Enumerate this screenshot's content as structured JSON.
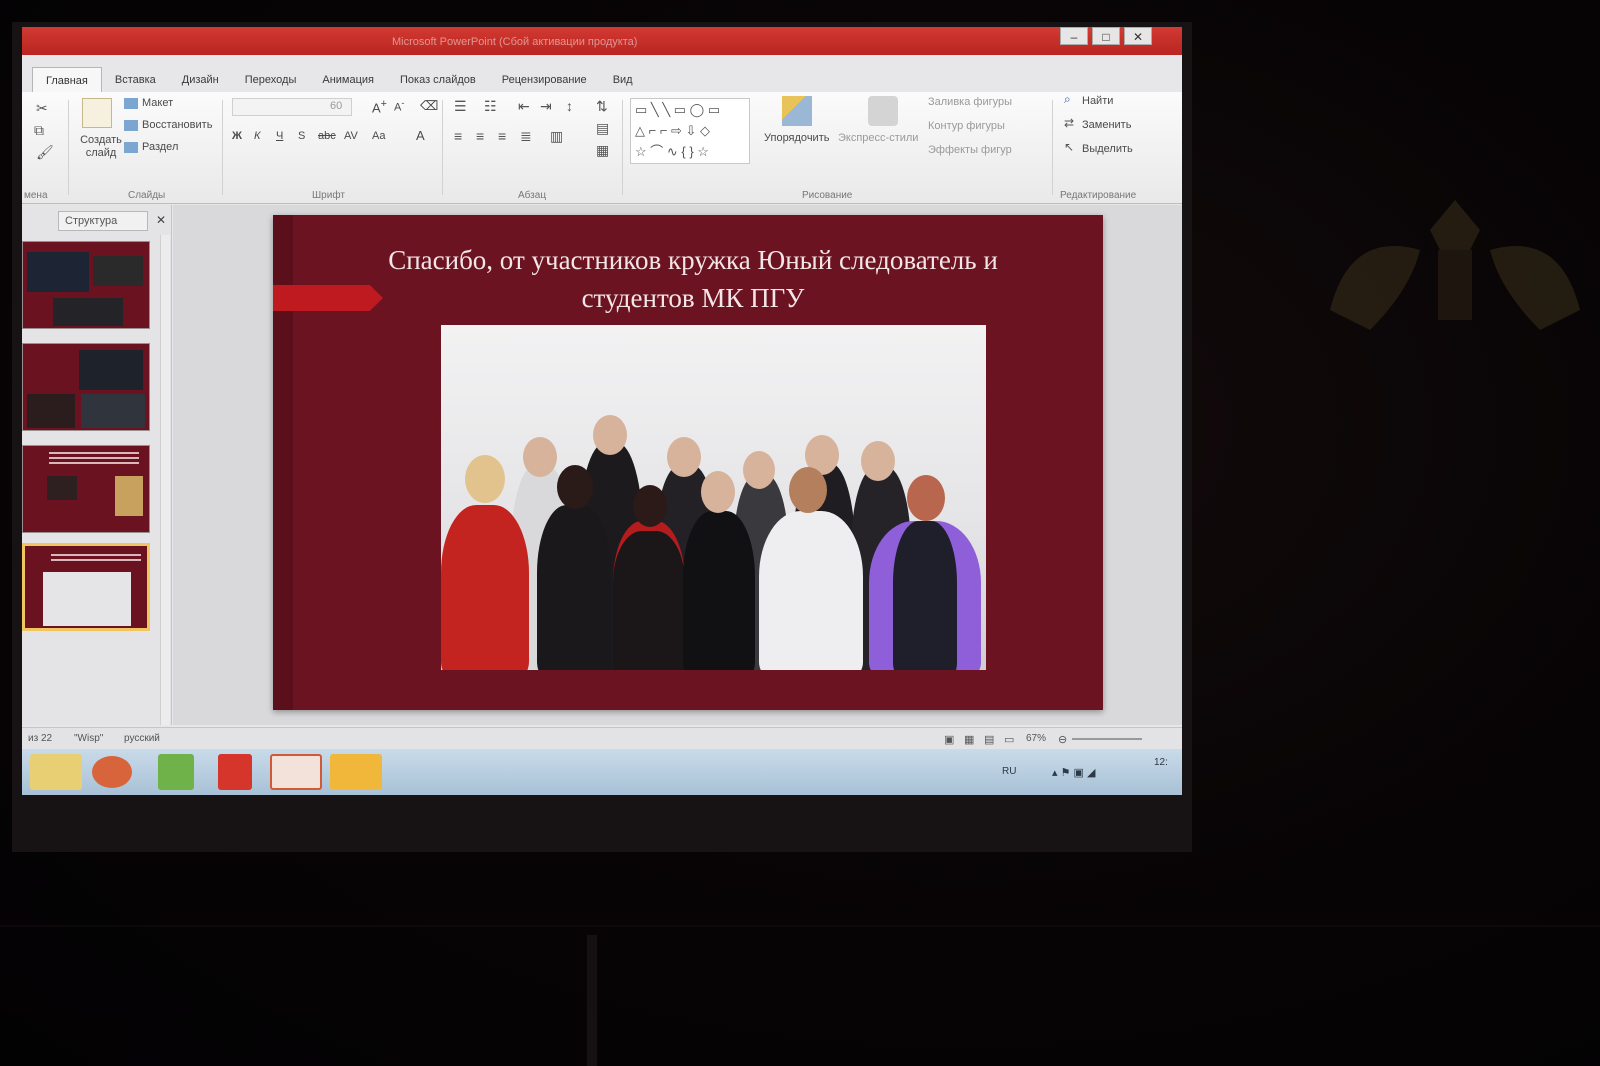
{
  "window": {
    "title": "Microsoft PowerPoint (Сбой активации продукта)",
    "controls": [
      "–",
      "□",
      "✕"
    ]
  },
  "ribbon_tabs": [
    "Главная",
    "Вставка",
    "Дизайн",
    "Переходы",
    "Анимация",
    "Показ слайдов",
    "Рецензирование",
    "Вид"
  ],
  "ribbon": {
    "create_slide": "Создать слайд",
    "layout": "Макет",
    "restore": "Восстановить",
    "section": "Раздел",
    "slides_group": "Слайды",
    "font_group": "Шрифт",
    "font_size": "60",
    "paragraph_group": "Абзац",
    "arrange": "Упорядочить",
    "quick_styles": "Экспресс-стили",
    "shape_fill": "Заливка фигуры",
    "shape_outline": "Контур фигуры",
    "shape_effects": "Эффекты фигур",
    "drawing_group": "Рисование",
    "find": "Найти",
    "replace": "Заменить",
    "select": "Выделить",
    "editing_group": "Редактирование",
    "clipboard_group": "мена",
    "font_buttons": [
      "Ж",
      "К",
      "Ч",
      "S",
      "abc",
      "AV",
      "Aa"
    ]
  },
  "panel": {
    "tab_label": "Структура",
    "close": "✕"
  },
  "slide": {
    "title_line1": "Спасибо, от участников кружка Юный следователь и",
    "title_line2": "студентов МК ПГУ"
  },
  "status_bar": {
    "slide_of": "из 22",
    "theme": "\"Wisp\"",
    "language": "русский",
    "zoom": "67%"
  },
  "taskbar": {
    "language": "RU",
    "time": "12:"
  },
  "colors": {
    "slide_bg": "#6c1322",
    "title_bar": "#c42d27",
    "accent_chevron": "#c01a21"
  }
}
